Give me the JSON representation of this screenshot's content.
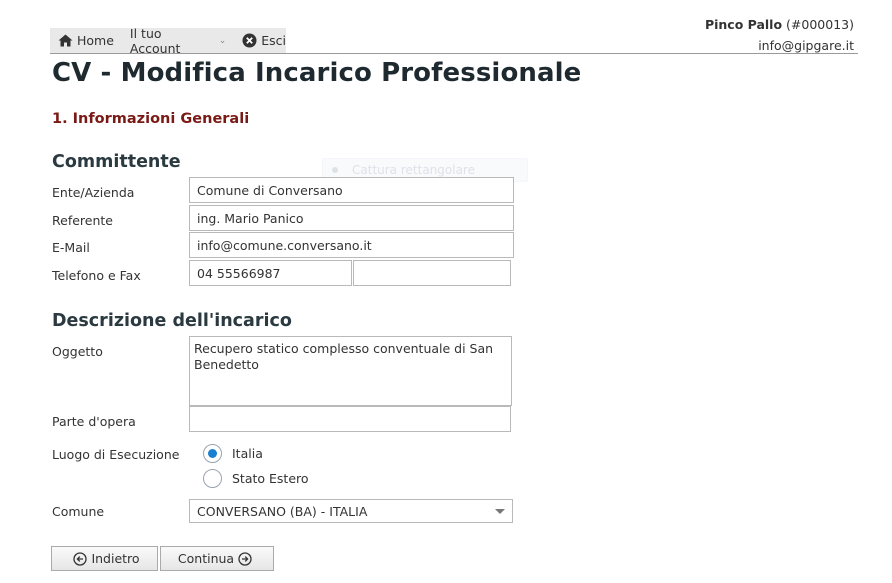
{
  "nav": {
    "home_label": "Home",
    "account_label": "Il tuo Account",
    "logout_label": "Esci"
  },
  "user": {
    "name": "Pinco Pallo",
    "id": "(#000013)",
    "email": "info@gipgare.it"
  },
  "page": {
    "title": "CV - Modifica Incarico Professionale",
    "step": "1. Informazioni Generali"
  },
  "ghost_overlay": "Cattura rettangolare",
  "committente": {
    "title": "Committente",
    "ente_label": "Ente/Azienda",
    "ente_value": "Comune di Conversano",
    "referente_label": "Referente",
    "referente_value": "ing. Mario Panico",
    "email_label": "E-Mail",
    "email_value": "info@comune.conversano.it",
    "tel_label": "Telefono e Fax",
    "tel_value": "04 55566987",
    "fax_value": ""
  },
  "descrizione": {
    "title": "Descrizione dell'incarico",
    "oggetto_label": "Oggetto",
    "oggetto_value": "Recupero statico complesso conventuale di San Benedetto",
    "parte_label": "Parte d'opera",
    "parte_value": "",
    "luogo_label": "Luogo di Esecuzione",
    "luogo_options": [
      "Italia",
      "Stato Estero"
    ],
    "luogo_selected": "Italia",
    "comune_label": "Comune",
    "comune_value": "CONVERSANO (BA) - ITALIA"
  },
  "buttons": {
    "back_label": "Indietro",
    "next_label": "Continua"
  },
  "colors": {
    "step_title": "#7a1a16",
    "radio_checked": "#1a7fd0",
    "navbar_bg": "#e9e9e9"
  }
}
